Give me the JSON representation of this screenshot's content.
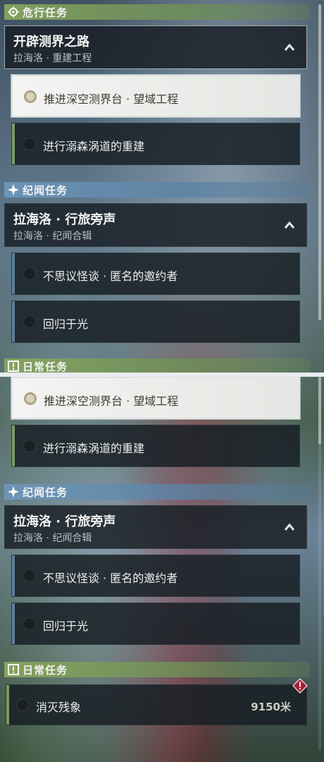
{
  "top": {
    "dangerous_header": "危行任务",
    "quest1": {
      "title": "开辟测界之路",
      "subtitle": "拉海洛 · 重建工程"
    },
    "quest1_steps": [
      "推进深空测界台 · 望域工程",
      "进行溺森涡道的重建"
    ],
    "chronicle_header": "纪闻任务",
    "quest2": {
      "title": "拉海洛 · 行旅旁声",
      "subtitle": "拉海洛 · 纪闻合辑"
    },
    "quest2_steps": [
      "不思议怪谈 · 匿名的邀约者",
      "回归于光"
    ],
    "daily_header_partial": "日常任务"
  },
  "bottom": {
    "quest1_steps": [
      "推进深空测界台 · 望域工程",
      "进行溺森涡道的重建"
    ],
    "chronicle_header": "纪闻任务",
    "quest2": {
      "title": "拉海洛 · 行旅旁声",
      "subtitle": "拉海洛 · 纪闻合辑"
    },
    "quest2_steps": [
      "不思议怪谈 · 匿名的邀约者",
      "回归于光"
    ],
    "daily_header": "日常任务",
    "daily_task": {
      "label": "消灭残象",
      "distance": "9150米"
    }
  },
  "colors": {
    "danger_accent": "#7d9a63",
    "chronicle_accent": "#5d7f9c",
    "alert": "#b0283a"
  },
  "icons": [
    "gear-icon",
    "sparkle-icon",
    "chevron-up-icon",
    "exclamation-icon",
    "warning-diamond-icon"
  ]
}
